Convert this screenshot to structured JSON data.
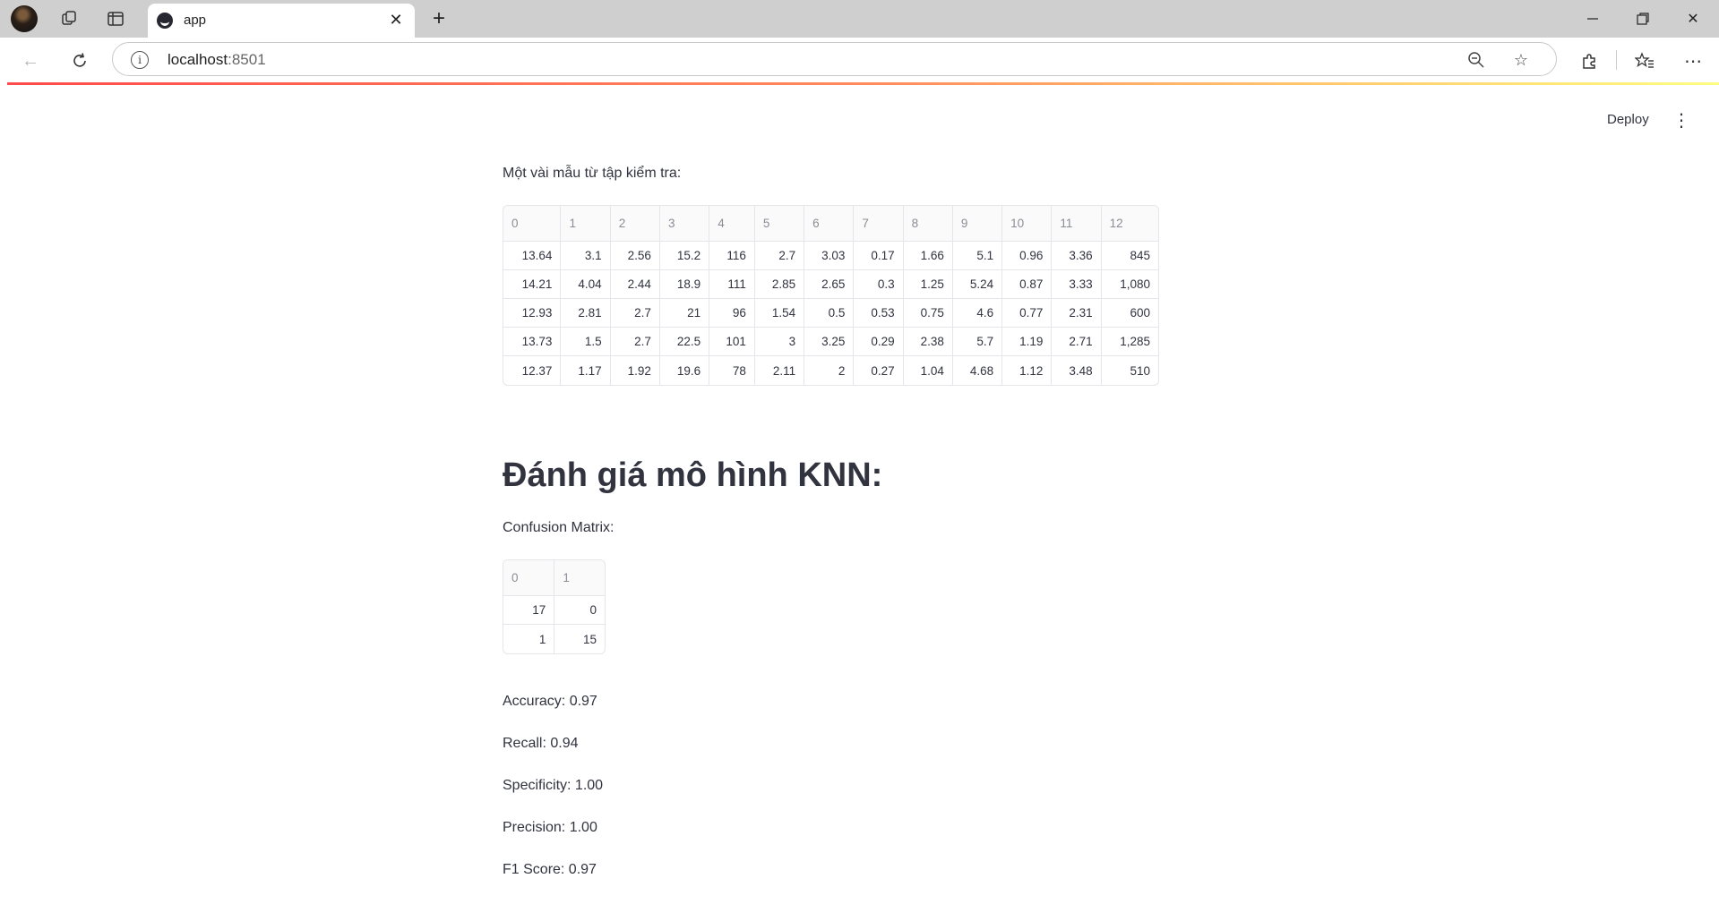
{
  "browser": {
    "tab_title": "app",
    "url_host": "localhost",
    "url_port": ":8501"
  },
  "app": {
    "deploy_label": "Deploy",
    "sample_caption": "Một vài mẫu từ tập kiểm tra:",
    "sample_table": {
      "headers": [
        "0",
        "1",
        "2",
        "3",
        "4",
        "5",
        "6",
        "7",
        "8",
        "9",
        "10",
        "11",
        "12"
      ],
      "rows": [
        [
          "13.64",
          "3.1",
          "2.56",
          "15.2",
          "116",
          "2.7",
          "3.03",
          "0.17",
          "1.66",
          "5.1",
          "0.96",
          "3.36",
          "845"
        ],
        [
          "14.21",
          "4.04",
          "2.44",
          "18.9",
          "111",
          "2.85",
          "2.65",
          "0.3",
          "1.25",
          "5.24",
          "0.87",
          "3.33",
          "1,080"
        ],
        [
          "12.93",
          "2.81",
          "2.7",
          "21",
          "96",
          "1.54",
          "0.5",
          "0.53",
          "0.75",
          "4.6",
          "0.77",
          "2.31",
          "600"
        ],
        [
          "13.73",
          "1.5",
          "2.7",
          "22.5",
          "101",
          "3",
          "3.25",
          "0.29",
          "2.38",
          "5.7",
          "1.19",
          "2.71",
          "1,285"
        ],
        [
          "12.37",
          "1.17",
          "1.92",
          "19.6",
          "78",
          "2.11",
          "2",
          "0.27",
          "1.04",
          "4.68",
          "1.12",
          "3.48",
          "510"
        ]
      ]
    },
    "eval_heading": "Đánh giá mô hình KNN:",
    "confusion_caption": "Confusion Matrix:",
    "confusion_table": {
      "headers": [
        "0",
        "1"
      ],
      "rows": [
        [
          "17",
          "0"
        ],
        [
          "1",
          "15"
        ]
      ]
    },
    "metrics": {
      "accuracy": "Accuracy: 0.97",
      "recall": "Recall: 0.94",
      "specificity": "Specificity: 1.00",
      "precision": "Precision: 1.00",
      "f1": "F1 Score: 0.97"
    }
  }
}
